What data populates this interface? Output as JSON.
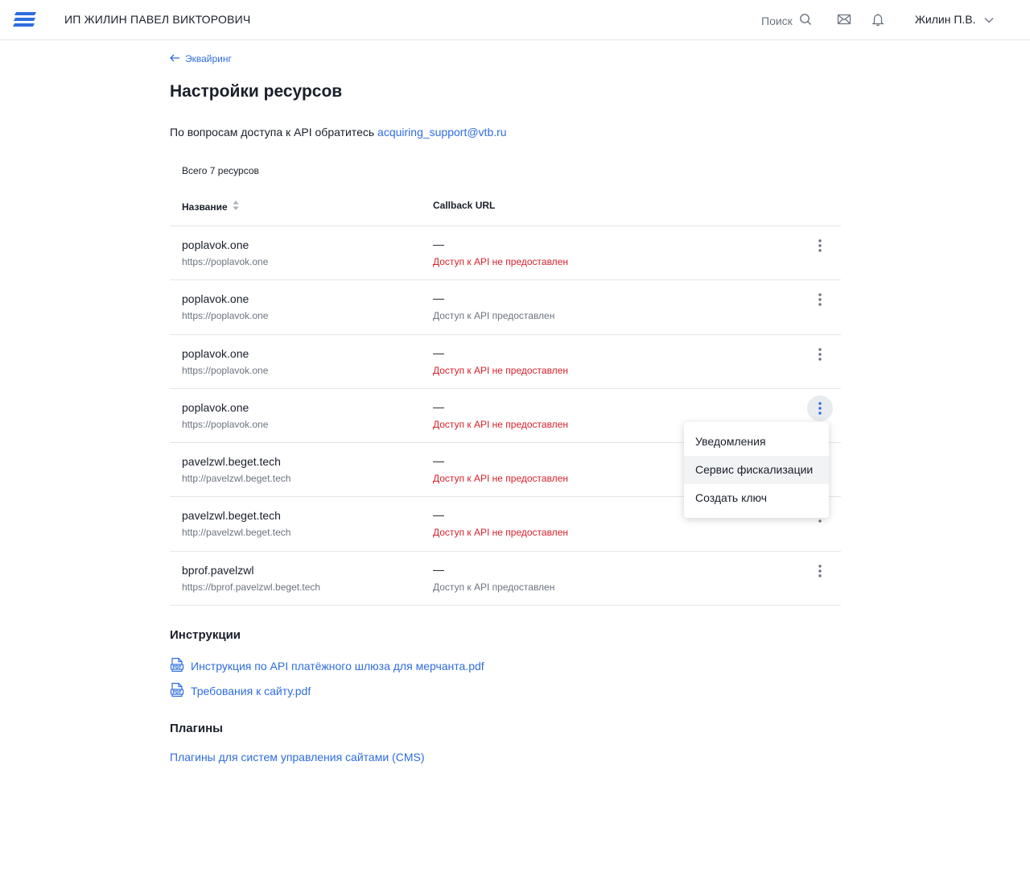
{
  "header": {
    "company_name": "ИП ЖИЛИН ПАВЕЛ ВИКТОРОВИЧ",
    "search_label": "Поиск",
    "user_name": "Жилин П.В.",
    "icons": [
      "menu-logo-icon",
      "search-icon",
      "mail-icon",
      "bell-icon",
      "chevron-down-icon"
    ]
  },
  "breadcrumb": {
    "back_label": "Эквайринг"
  },
  "page": {
    "title": "Настройки ресурсов",
    "api_note_prefix": "По вопросам доступа к API обратитесь",
    "support_email": "acquiring_support@vtb.ru"
  },
  "table": {
    "total_label": "Всего 7 ресурсов",
    "columns": {
      "name": "Название",
      "callback": "Callback URL"
    },
    "rows": [
      {
        "name": "poplavok.one",
        "url": "https://poplavok.one",
        "callback": "—",
        "status": "Доступ к API не предоставлен",
        "denied": true
      },
      {
        "name": "poplavok.one",
        "url": "https://poplavok.one",
        "callback": "—",
        "status": "Доступ к API предоставлен",
        "denied": false
      },
      {
        "name": "poplavok.one",
        "url": "https://poplavok.one",
        "callback": "—",
        "status": "Доступ к API не предоставлен",
        "denied": true
      },
      {
        "name": "poplavok.one",
        "url": "https://poplavok.one",
        "callback": "—",
        "status": "Доступ к API не предоставлен",
        "denied": true,
        "menu_open": true
      },
      {
        "name": "pavelzwl.beget.tech",
        "url": "http://pavelzwl.beget.tech",
        "callback": "—",
        "status": "Доступ к API не предоставлен",
        "denied": true
      },
      {
        "name": "pavelzwl.beget.tech",
        "url": "http://pavelzwl.beget.tech",
        "callback": "—",
        "status": "Доступ к API не предоставлен",
        "denied": true
      },
      {
        "name": "bprof.pavelzwl",
        "url": "https://bprof.pavelzwl.beget.tech",
        "callback": "—",
        "status": "Доступ к API предоставлен",
        "denied": false
      }
    ]
  },
  "dropdown": {
    "items": [
      "Уведомления",
      "Сервис фискализации",
      "Создать ключ"
    ],
    "highlighted_index": 1
  },
  "instructions": {
    "title": "Инструкции",
    "links": [
      "Инструкция по API платёжного шлюза для мерчанта.pdf",
      "Требования к сайту.pdf"
    ]
  },
  "plugins": {
    "title": "Плагины",
    "link": "Плагины для систем управления сайтами (CMS)"
  },
  "colors": {
    "accent": "#2f6de0",
    "denied": "#d9202b",
    "muted": "#6c7480",
    "logo": "#2f6de0"
  }
}
